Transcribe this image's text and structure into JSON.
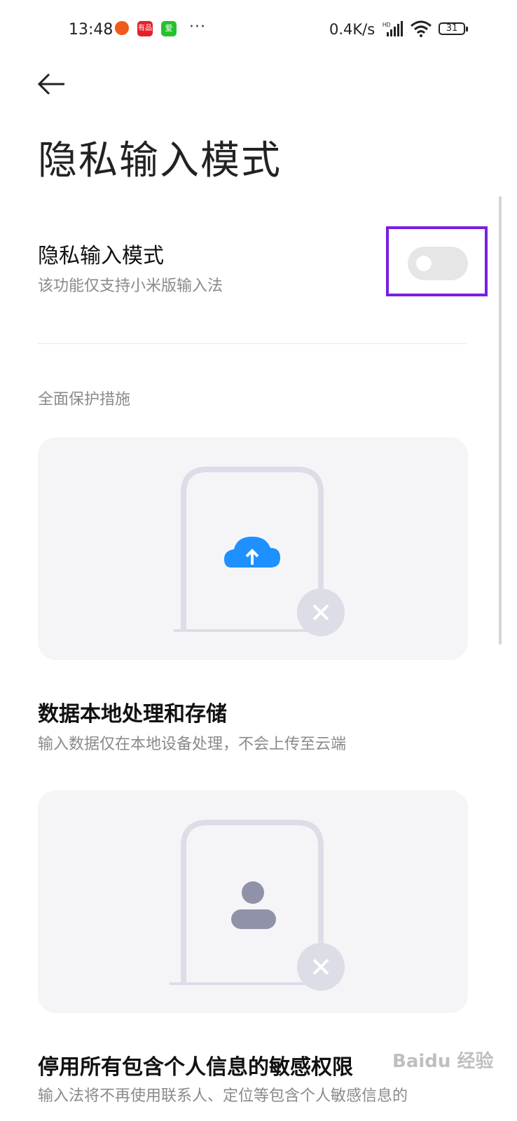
{
  "status_bar": {
    "time": "13:48",
    "app1_label": "有品",
    "app2_label": "爱",
    "dots": "···",
    "net_speed": "0.4K/s",
    "signal_tag": "HD",
    "battery": "31"
  },
  "header": {
    "title": "隐私输入模式"
  },
  "setting": {
    "title": "隐私输入模式",
    "subtitle": "该功能仅支持小米版输入法",
    "toggle_on": false
  },
  "section": {
    "header": "全面保护措施"
  },
  "features": [
    {
      "title": "数据本地处理和存储",
      "desc": "输入数据仅在本地设备处理，不会上传至云端",
      "icon": "cloud-upload-icon"
    },
    {
      "title": "停用所有包含个人信息的敏感权限",
      "desc": "输入法将不再使用联系人、定位等包含个人敏感信息的",
      "icon": "person-icon"
    }
  ],
  "watermark": "Baidu 经验",
  "colors": {
    "accent_blue": "#1e90ff",
    "highlight_purple": "#7a1ee3",
    "card_bg": "#f5f5f8"
  }
}
